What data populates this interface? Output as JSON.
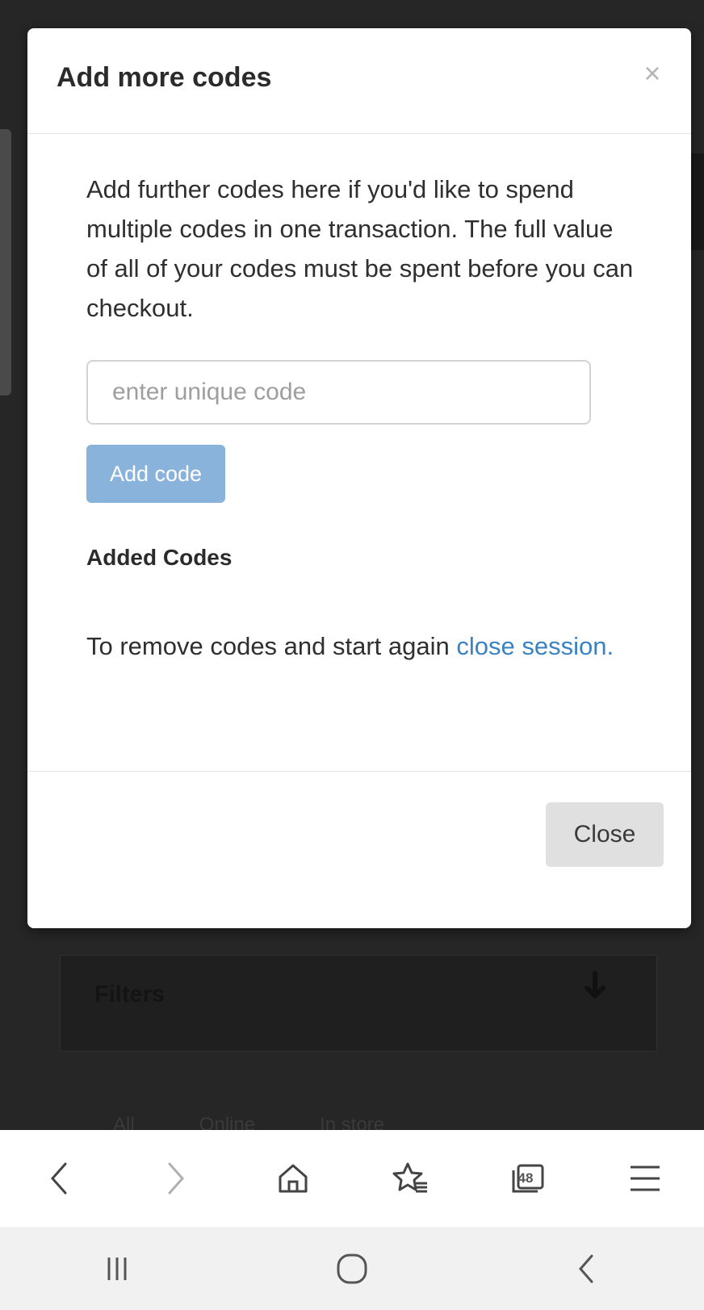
{
  "modal": {
    "title": "Add more codes",
    "close_icon": "close-x-icon",
    "close_glyph": "×",
    "intro": "Add further codes here if you'd like to spend multiple codes in one transaction. The full value of all of your codes must be spent before you can checkout.",
    "input_placeholder": "enter unique code",
    "input_value": "",
    "add_button_label": "Add code",
    "added_codes_heading": "Added Codes",
    "remove_text": "To remove codes and start again ",
    "close_session_link": "close session.",
    "footer_close_label": "Close"
  },
  "background": {
    "filters_label": "Filters",
    "filters_icon": "arrow-down-icon",
    "tabs": [
      "All",
      "Online",
      "In store"
    ]
  },
  "browser_toolbar": {
    "items": [
      {
        "icon": "back-arrow-icon"
      },
      {
        "icon": "forward-arrow-icon"
      },
      {
        "icon": "home-icon"
      },
      {
        "icon": "bookmarks-star-icon"
      },
      {
        "icon": "tabs-icon",
        "count": "48"
      },
      {
        "icon": "menu-icon"
      }
    ]
  },
  "system_nav": {
    "items": [
      {
        "icon": "recent-apps-icon"
      },
      {
        "icon": "home-circle-icon"
      },
      {
        "icon": "system-back-icon"
      }
    ]
  },
  "colors": {
    "overlay": "#2b2b2b",
    "primary_disabled": "#8ab3dc",
    "link": "#3b82c2",
    "close_button": "#e0e0e0"
  }
}
